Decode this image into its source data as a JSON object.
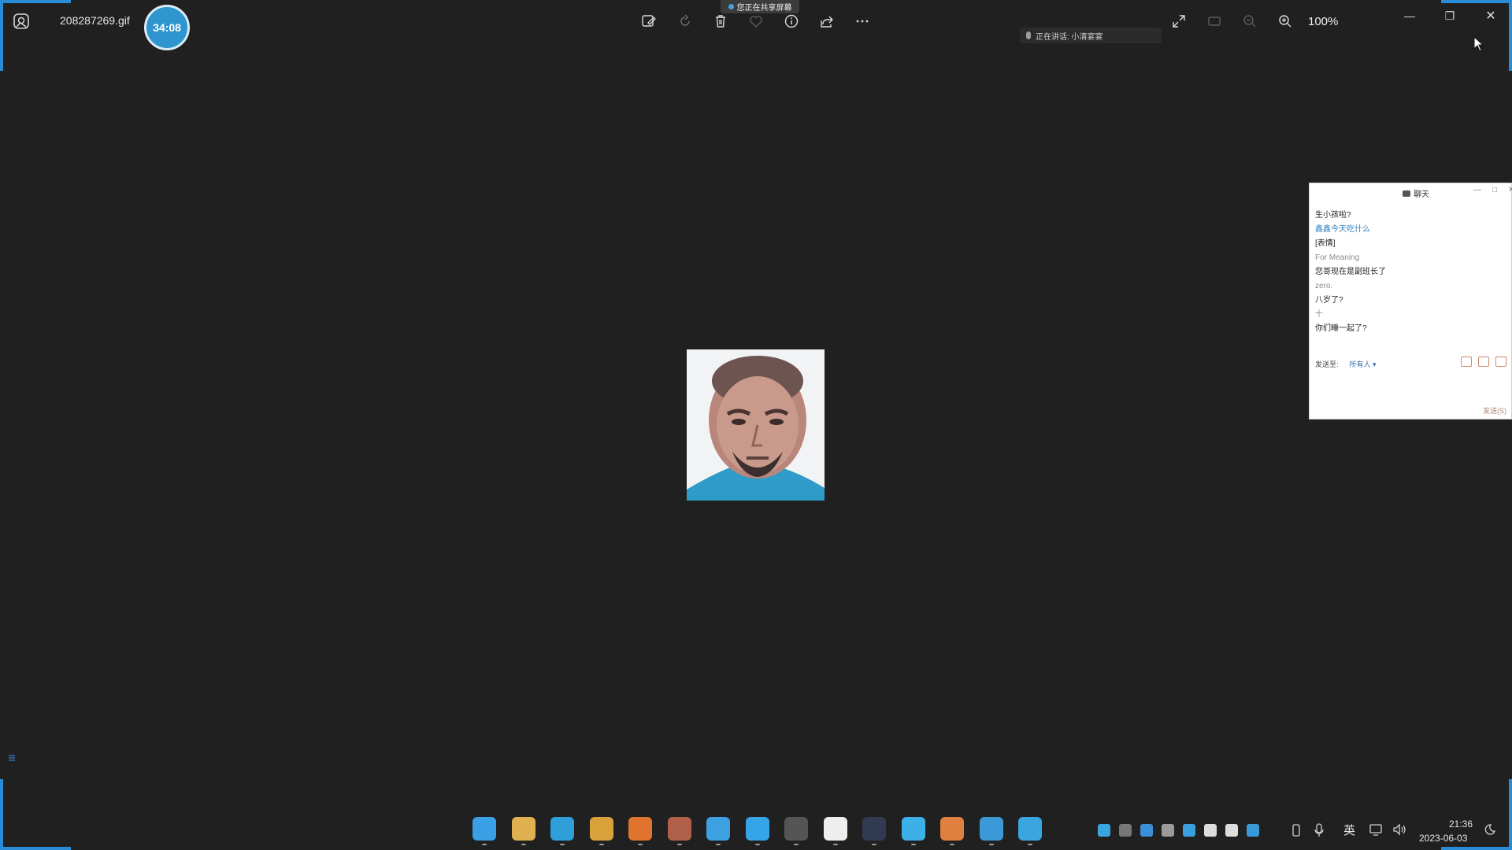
{
  "window": {
    "file_name": "208287269.gif",
    "timer": "34:08",
    "share_banner": "您正在共享屏幕",
    "speaking_label": "正在讲话: 小清宴宴",
    "zoom_level": "100%"
  },
  "toolbar": {
    "icons": [
      "edit-image-icon",
      "rotate-icon",
      "delete-icon",
      "favorite-icon",
      "info-icon",
      "share-icon",
      "more-icon"
    ]
  },
  "view_controls": {
    "icons": [
      "fullscreen-icon",
      "fit-icon",
      "zoom-out-icon",
      "zoom-in-icon"
    ]
  },
  "window_controls": {
    "minimize": "—",
    "restore": "❐",
    "close": "✕"
  },
  "chat": {
    "title": "聊天",
    "messages": [
      {
        "kind": "body",
        "text": "生小孩啦?"
      },
      {
        "kind": "blue",
        "text": "鑫鑫今天吃什么"
      },
      {
        "kind": "body",
        "text": "[表情]"
      },
      {
        "kind": "name",
        "text": "For Meaning"
      },
      {
        "kind": "body",
        "text": "您哥现在是副班长了"
      },
      {
        "kind": "name",
        "text": "zero."
      },
      {
        "kind": "body",
        "text": "八岁了?"
      },
      {
        "kind": "name",
        "text": "十"
      },
      {
        "kind": "body",
        "text": "你们睡一起了?"
      }
    ],
    "send_to_label": "发送至:",
    "send_to_target": "所有人 ▾",
    "send_button": "发送(S)"
  },
  "taskbar": {
    "apps": [
      {
        "name": "start-button",
        "color": "#3aa0e6"
      },
      {
        "name": "file-explorer-app",
        "color": "#e0b050"
      },
      {
        "name": "edge-app",
        "color": "#2e9fd8"
      },
      {
        "name": "chrome-app",
        "color": "#d9a13a"
      },
      {
        "name": "firefox-app",
        "color": "#e0742e"
      },
      {
        "name": "steam-app",
        "color": "#b06048"
      },
      {
        "name": "typora-app",
        "color": "#3da0e0"
      },
      {
        "name": "meeting-app",
        "color": "#36a5e8"
      },
      {
        "name": "github-app",
        "color": "#555555"
      },
      {
        "name": "jar-app",
        "color": "#eeeeee"
      },
      {
        "name": "photoshop-app",
        "color": "#303a52"
      },
      {
        "name": "vpn-app",
        "color": "#3db0e8"
      },
      {
        "name": "sublime-app",
        "color": "#e08040"
      },
      {
        "name": "remote-desktop-app",
        "color": "#3a9ad8"
      },
      {
        "name": "photos-app",
        "color": "#3aa6e0"
      }
    ],
    "tray_icons": [
      {
        "name": "cloud-tray-icon",
        "color": "#3aa6e0"
      },
      {
        "name": "camera-tray-icon",
        "color": "#777777"
      },
      {
        "name": "shield-tray-icon",
        "color": "#3a8fd8"
      },
      {
        "name": "network-tray-icon",
        "color": "#9a9a9a"
      },
      {
        "name": "app-tray-icon",
        "color": "#3aa0e0"
      },
      {
        "name": "gear-tray-icon",
        "color": "#dddddd"
      },
      {
        "name": "display-tray-icon",
        "color": "#dddddd"
      },
      {
        "name": "monitor-tray-icon",
        "color": "#3a9ad8"
      }
    ],
    "ime_label": "英",
    "time": "21:36",
    "date": "2023-06-03"
  }
}
